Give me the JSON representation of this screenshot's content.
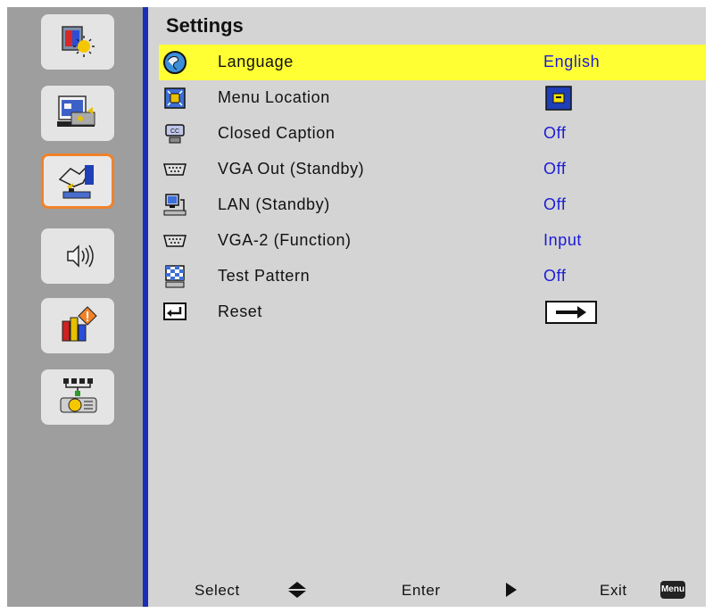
{
  "title": "Settings",
  "menu": [
    {
      "label": "Language",
      "value": "English",
      "icon": "globe-icon",
      "selected": true
    },
    {
      "label": "Menu Location",
      "value": "",
      "icon": "menu-location-icon"
    },
    {
      "label": "Closed Caption",
      "value": "Off",
      "icon": "closed-caption-icon"
    },
    {
      "label": "VGA Out (Standby)",
      "value": "Off",
      "icon": "vga-port-icon"
    },
    {
      "label": "LAN (Standby)",
      "value": "Off",
      "icon": "lan-icon"
    },
    {
      "label": "VGA-2 (Function)",
      "value": "Input",
      "icon": "vga-port-icon"
    },
    {
      "label": "Test Pattern",
      "value": "Off",
      "icon": "test-pattern-icon"
    },
    {
      "label": "Reset",
      "value": "",
      "icon": "return-icon"
    }
  ],
  "footer": {
    "select": "Select",
    "enter": "Enter",
    "exit": "Exit",
    "menu_key": "Menu"
  },
  "colors": {
    "selection": "#ffff33",
    "value_text": "#1b1bd6",
    "active_tab_border": "#f0822a",
    "divider": "#1a2fb5"
  },
  "sidebar_tabs": [
    "image-tab-icon",
    "display-tab-icon",
    "setup-tab-icon",
    "audio-tab-icon",
    "options-tab-icon",
    "network-tab-icon"
  ]
}
